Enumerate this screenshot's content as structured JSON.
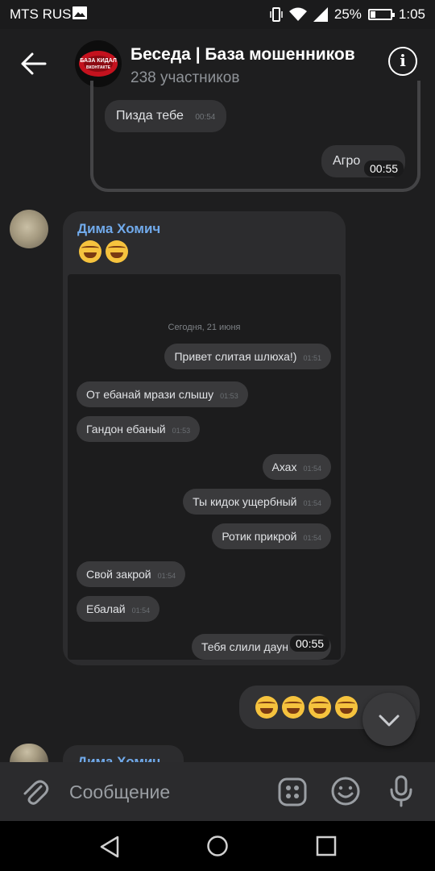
{
  "status": {
    "carrier": "MTS RUS",
    "battery": "25%",
    "time": "1:05"
  },
  "header": {
    "title": "Беседа | База мошенников",
    "subtitle": "238 участников",
    "avatar_logo_line1": "БАЗА КИДАЛ",
    "avatar_logo_line2": "ВКОНТАКТЕ"
  },
  "forwarded": {
    "msg1": {
      "text": "Пизда тебе",
      "time": "00:54"
    },
    "video": {
      "text": "Агро",
      "duration": "00:55"
    }
  },
  "message": {
    "sender": "Дима Хомич",
    "screenshot": {
      "date": "Сегодня, 21 июня",
      "bubbles": [
        {
          "text": "Привет слитая шлюха!)",
          "time": "01:51",
          "side": "right"
        },
        {
          "text": "От ебанай мрази слышу",
          "time": "01:53",
          "side": "left"
        },
        {
          "text": "Гандон ебаный",
          "time": "01:53",
          "side": "left"
        },
        {
          "text": "Ахах",
          "time": "01:54",
          "side": "right"
        },
        {
          "text": "Ты кидок ущербный",
          "time": "01:54",
          "side": "right"
        },
        {
          "text": "Ротик прикрой",
          "time": "01:54",
          "side": "right"
        },
        {
          "text": "Свой закрой",
          "time": "01:54",
          "side": "left"
        },
        {
          "text": "Ебалай",
          "time": "01:54",
          "side": "left"
        },
        {
          "text": "Тебя слили даун",
          "side": "right"
        }
      ],
      "video_duration": "00:55"
    }
  },
  "next_sender": "Дима Хомич",
  "composer": {
    "placeholder": "Сообщение"
  },
  "icons": {
    "back": "arrow-left-icon",
    "info": "info-icon",
    "attach": "paperclip-icon",
    "stickers": "stickers-icon",
    "emoji": "emoji-icon",
    "mic": "microphone-icon"
  }
}
